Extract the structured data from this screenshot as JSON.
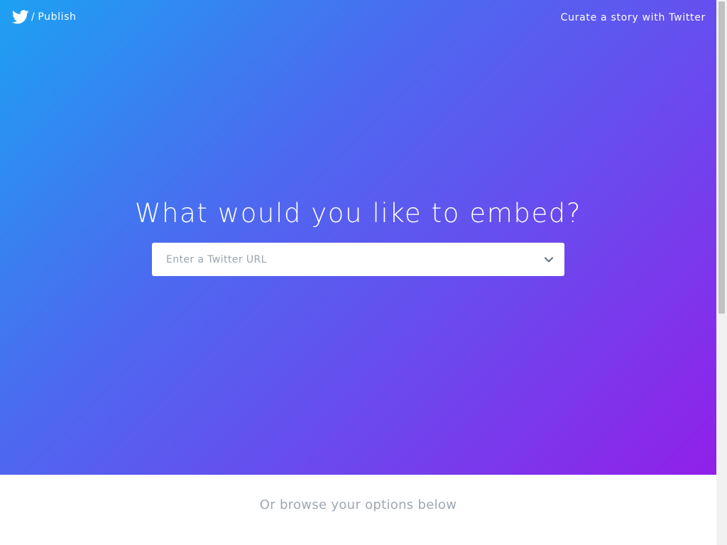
{
  "header": {
    "brand_icon": "twitter-bird-icon",
    "separator": "/",
    "brand_label": "Publish",
    "curate_link": "Curate a story with Twitter"
  },
  "hero": {
    "headline": "What would you like to embed?",
    "url_input": {
      "value": "",
      "placeholder": "Enter a Twitter URL"
    },
    "dropdown_icon": "chevron-down-icon",
    "gradient_colors": [
      "#1da1f2",
      "#4a6cf0",
      "#6a4aee",
      "#9120e8"
    ]
  },
  "browse": {
    "text": "Or browse your options below"
  },
  "colors": {
    "text_on_gradient": "#ffffff",
    "placeholder": "#9aa3ad",
    "browse_text": "#a0a7b0",
    "chevron": "#6b7785"
  }
}
